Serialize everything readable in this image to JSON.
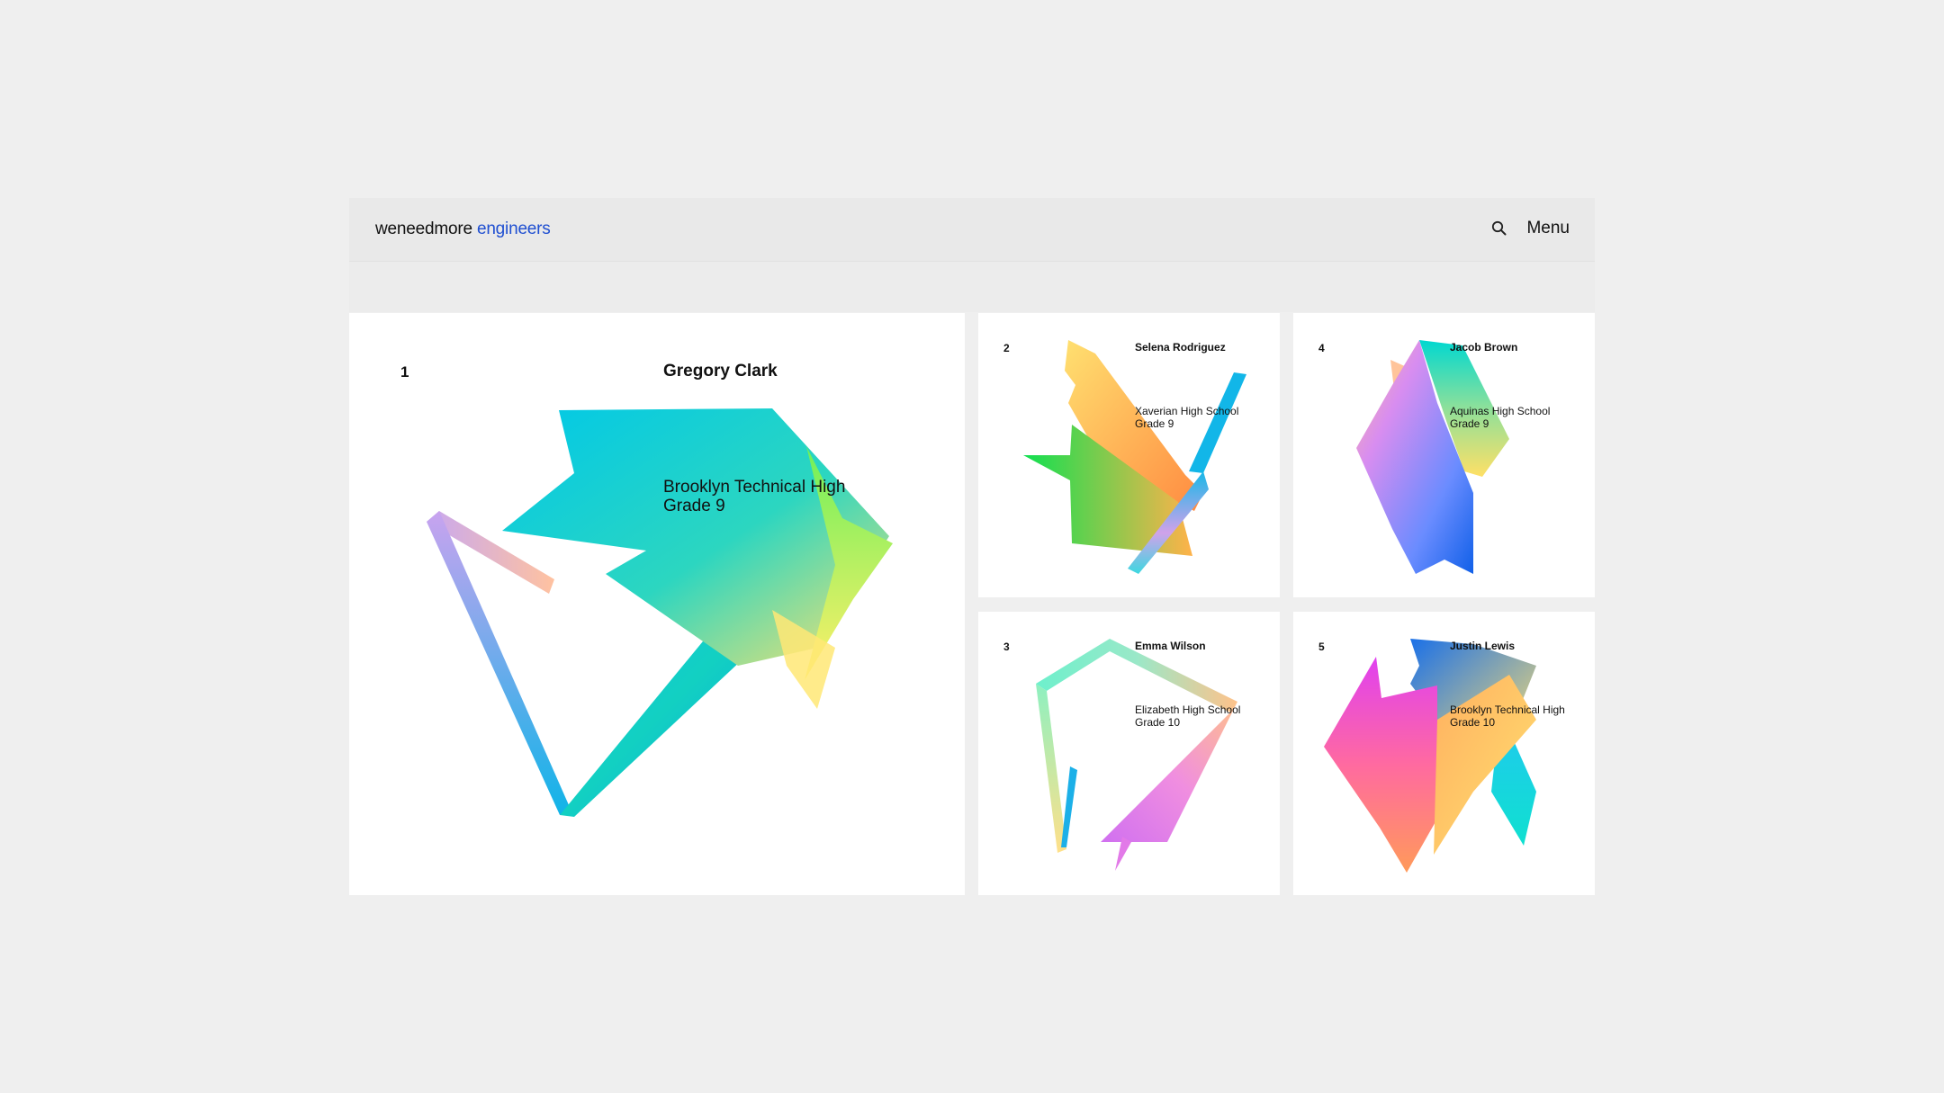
{
  "header": {
    "logo_main": "weneedmore",
    "logo_accent": "engineers",
    "menu_label": "Menu",
    "accent_color": "#1f4fd1"
  },
  "cards": [
    {
      "number": "1",
      "name": "Gregory Clark",
      "school": "Brooklyn Technical High",
      "grade": "Grade 9"
    },
    {
      "number": "2",
      "name": "Selena Rodriguez",
      "school": "Xaverian High School",
      "grade": "Grade 9"
    },
    {
      "number": "3",
      "name": "Emma Wilson",
      "school": "Elizabeth High School",
      "grade": "Grade 10"
    },
    {
      "number": "4",
      "name": "Jacob Brown",
      "school": "Aquinas High School",
      "grade": "Grade 9"
    },
    {
      "number": "5",
      "name": "Justin Lewis",
      "school": "Brooklyn Technical High",
      "grade": "Grade 10"
    }
  ],
  "icons": {
    "search": "search-icon"
  }
}
